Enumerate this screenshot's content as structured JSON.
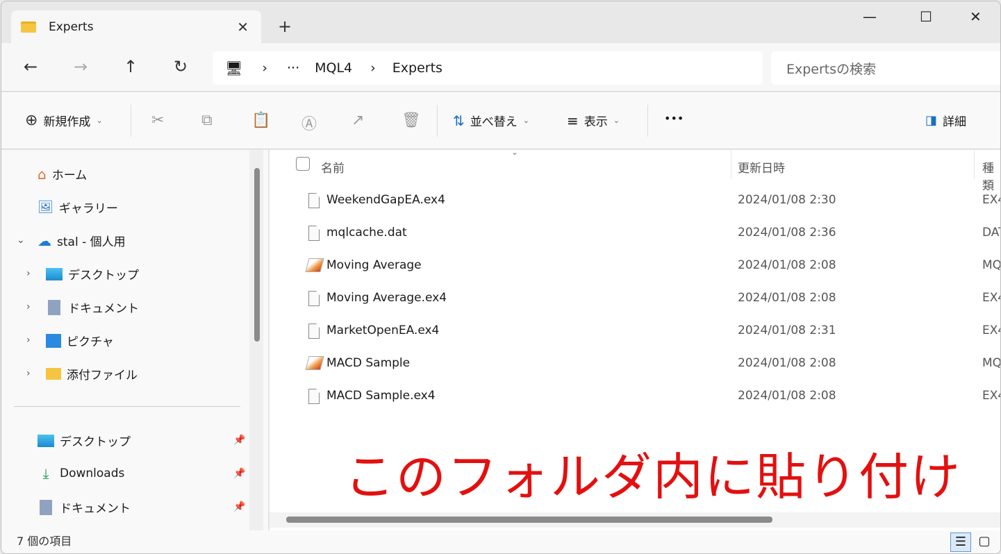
{
  "tab": {
    "title": "Experts",
    "close": "✕",
    "new_tab": "+"
  },
  "window": {
    "minimize": "—",
    "maximize": "☐",
    "close": "✕"
  },
  "nav": {
    "back": "←",
    "forward": "→",
    "up": "↑",
    "refresh": "↻"
  },
  "breadcrumb": {
    "computer_icon": "🖥",
    "sep": "›",
    "ellipsis": "···",
    "items": [
      "MQL4",
      "Experts"
    ]
  },
  "search": {
    "placeholder": "Expertsの検索"
  },
  "toolbar": {
    "new": "新規作成",
    "sort": "並べ替え",
    "view": "表示",
    "more": "•••",
    "details": "詳細",
    "icons": {
      "cut": "✂",
      "copy": "⧉",
      "paste": "📋",
      "rename": "Ⓐ",
      "share": "↗",
      "delete": "🗑"
    }
  },
  "sidebar": {
    "top": [
      {
        "label": "ホーム",
        "icon": "⌂"
      },
      {
        "label": "ギャラリー",
        "icon": "🖼"
      },
      {
        "label": "stal - 個人用",
        "icon": "☁"
      }
    ],
    "children": [
      {
        "label": "デスクトップ"
      },
      {
        "label": "ドキュメント"
      },
      {
        "label": "ピクチャ"
      },
      {
        "label": "添付ファイル"
      }
    ],
    "quick": [
      {
        "label": "デスクトップ"
      },
      {
        "label": "Downloads"
      },
      {
        "label": "ドキュメント"
      }
    ]
  },
  "columns": {
    "name": "名前",
    "modified": "更新日時",
    "type": "種類"
  },
  "files": [
    {
      "name": "WeekendGapEA.ex4",
      "date": "2024/01/08 2:30",
      "type": "EX4",
      "icon": "file"
    },
    {
      "name": "mqlcache.dat",
      "date": "2024/01/08 2:36",
      "type": "DAT",
      "icon": "file"
    },
    {
      "name": "Moving Average",
      "date": "2024/01/08 2:08",
      "type": "MQ",
      "icon": "mq4"
    },
    {
      "name": "Moving Average.ex4",
      "date": "2024/01/08 2:08",
      "type": "EX4",
      "icon": "file"
    },
    {
      "name": "MarketOpenEA.ex4",
      "date": "2024/01/08 2:31",
      "type": "EX4",
      "icon": "file"
    },
    {
      "name": "MACD Sample",
      "date": "2024/01/08 2:08",
      "type": "MQ",
      "icon": "mq4"
    },
    {
      "name": "MACD Sample.ex4",
      "date": "2024/01/08 2:08",
      "type": "EX4",
      "icon": "file"
    }
  ],
  "annotation": "このフォルダ内に貼り付け",
  "annotation_color": "#e3100f",
  "status": {
    "count": "7 個の項目"
  }
}
